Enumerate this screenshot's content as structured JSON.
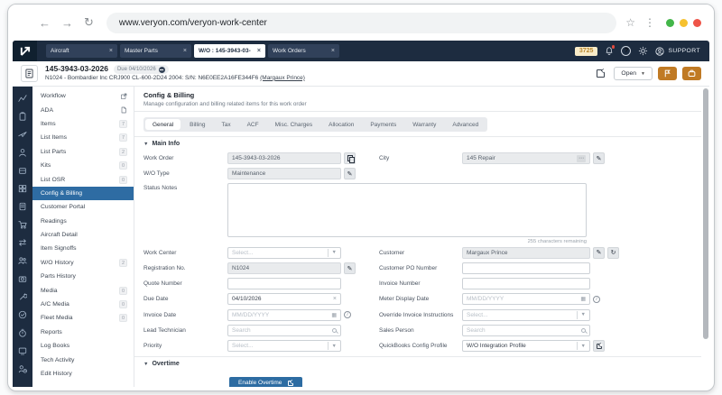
{
  "browser": {
    "url": "www.veryon.com/veryon-work-center"
  },
  "topbar": {
    "tabs": [
      {
        "label": "Aircraft",
        "active": false
      },
      {
        "label": "Master Parts",
        "active": false
      },
      {
        "label": "W/O : 145-3943-03-",
        "active": true
      },
      {
        "label": "Work Orders",
        "active": false
      }
    ],
    "counter": "3725",
    "support_label": "SUPPORT"
  },
  "header": {
    "work_order": "145-3943-03-2026",
    "due_badge": "Due 04/10/2026",
    "aircraft_line": "N1024 - Bombardier Inc CRJ900 CL-600-2D24 2004: S/N: N6E0EE2A16FE344F6",
    "aircraft_link": "(Margaux Prince)",
    "open_label": "Open"
  },
  "rail": {
    "icons": [
      "chart-icon",
      "clipboard-icon",
      "airplane-icon",
      "pilot-icon",
      "parts-icon",
      "grid-icon",
      "document-icon",
      "cart-icon",
      "transfer-icon",
      "users-icon",
      "camera-icon",
      "wrench-icon",
      "check-circle-icon",
      "stopwatch-icon",
      "monitor-icon",
      "user-clock-icon"
    ]
  },
  "sidebar": {
    "items": [
      {
        "label": "Workflow",
        "icon": "external-link-icon"
      },
      {
        "label": "ADA",
        "icon": "file-icon"
      },
      {
        "label": "Items",
        "badge": "7"
      },
      {
        "label": "List Items",
        "badge": "7"
      },
      {
        "label": "List Parts",
        "badge": "2"
      },
      {
        "label": "Kits",
        "badge": "0"
      },
      {
        "label": "List OSR",
        "badge": "0"
      },
      {
        "label": "Config & Billing",
        "selected": true
      },
      {
        "label": "Customer Portal"
      },
      {
        "label": "Readings"
      },
      {
        "label": "Aircraft Detail"
      },
      {
        "label": "Item Signoffs"
      },
      {
        "label": "W/O History",
        "badge": "2"
      },
      {
        "label": "Parts History"
      },
      {
        "label": "Media",
        "badge": "0"
      },
      {
        "label": "A/C Media",
        "badge": "0"
      },
      {
        "label": "Fleet Media",
        "badge": "0"
      },
      {
        "label": "Reports"
      },
      {
        "label": "Log Books"
      },
      {
        "label": "Tech Activity"
      },
      {
        "label": "Edit History"
      }
    ]
  },
  "panel": {
    "title": "Config & Billing",
    "subtitle": "Manage configuration and billing related items for this work order",
    "tabs": [
      "General",
      "Billing",
      "Tax",
      "ACF",
      "Misc. Charges",
      "Allocation",
      "Payments",
      "Warranty",
      "Advanced"
    ],
    "active_tab": "General",
    "main_info_title": "Main Info",
    "overtime_title": "Overtime",
    "chars_remaining": "255 characters remaining",
    "enable_overtime_label": "Enable Overtime"
  },
  "form": {
    "work_order": {
      "label": "Work Order",
      "value": "145-3943-03-2026"
    },
    "city": {
      "label": "City",
      "value": "145 Repair"
    },
    "wo_type": {
      "label": "W/O Type",
      "value": "Maintenance"
    },
    "status_notes": {
      "label": "Status Notes",
      "value": ""
    },
    "work_center": {
      "label": "Work Center",
      "placeholder": "Select..."
    },
    "customer": {
      "label": "Customer",
      "value": "Margaux Prince"
    },
    "registration_no": {
      "label": "Registration No.",
      "value": "N1024"
    },
    "customer_po": {
      "label": "Customer PO Number",
      "value": ""
    },
    "quote_number": {
      "label": "Quote Number",
      "value": ""
    },
    "invoice_number": {
      "label": "Invoice Number",
      "value": ""
    },
    "due_date": {
      "label": "Due Date",
      "value": "04/10/2026"
    },
    "meter_display_date": {
      "label": "Meter Display Date",
      "placeholder": "MM/DD/YYYY"
    },
    "invoice_date": {
      "label": "Invoice Date",
      "placeholder": "MM/DD/YYYY"
    },
    "override_invoice": {
      "label": "Override Invoice Instructions",
      "placeholder": "Select..."
    },
    "lead_technician": {
      "label": "Lead Technician",
      "placeholder": "Search"
    },
    "sales_person": {
      "label": "Sales Person",
      "placeholder": "Search"
    },
    "priority": {
      "label": "Priority",
      "placeholder": "Select..."
    },
    "quickbooks_profile": {
      "label": "QuickBooks Config Profile",
      "value": "W/O Integration Profile"
    }
  },
  "colors": {
    "navy": "#1d2c40",
    "accent_blue": "#2e6ca3",
    "orange": "#c07a24",
    "counter_bg": "#f9ecc8",
    "counter_text": "#b8862f",
    "button_blue": "#2d6ca2"
  }
}
